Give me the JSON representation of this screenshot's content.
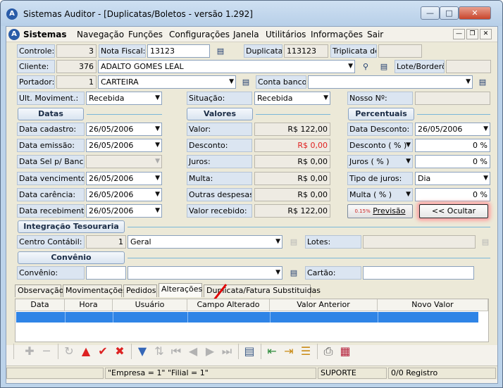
{
  "window": {
    "title": "Sistemas Auditor - [Duplicatas/Boletos - versão 1.292]",
    "app_icon": "auditor-logo-icon"
  },
  "menu": {
    "brand": "Sistemas",
    "items": [
      "Navegação",
      "Funções",
      "Configurações",
      "Janela",
      "Utilitários",
      "Informações",
      "Sair"
    ]
  },
  "header": {
    "controle_label": "Controle:",
    "controle_value": "3",
    "nota_label": "Nota Fiscal:",
    "nota_value": "13123",
    "duplicata_label": "Duplicata:",
    "duplicata_value": "113123",
    "triplicata_label": "Triplicata de:",
    "triplicata_value": "",
    "cliente_label": "Cliente:",
    "cliente_code": "376",
    "cliente_name": "ADALTO GOMES LEAL",
    "lote_label": "Lote/Borderô:",
    "lote_value": "",
    "portador_label": "Portador:",
    "portador_code": "1",
    "portador_name": "CARTEIRA",
    "conta_label": "Conta banco:",
    "conta_value": "",
    "ult_label": "Ult. Moviment.:",
    "ult_value": "Recebida",
    "situacao_label": "Situação:",
    "situacao_value": "Recebida",
    "nosso_label": "Nosso Nº:",
    "nosso_value": ""
  },
  "datas": {
    "title": "Datas",
    "rows": [
      {
        "label": "Data cadastro:",
        "value": "26/05/2006"
      },
      {
        "label": "Data emissão:",
        "value": "26/05/2006"
      },
      {
        "label": "Data Sel p/ Banco:",
        "value": ""
      },
      {
        "label": "Data vencimento:",
        "value": "26/05/2006"
      },
      {
        "label": "Data carência:",
        "value": "26/05/2006"
      },
      {
        "label": "Data recebimento:",
        "value": "26/05/2006"
      }
    ]
  },
  "valores": {
    "title": "Valores",
    "rows": [
      {
        "label": "Valor:",
        "value": "R$ 122,00"
      },
      {
        "label": "Desconto:",
        "value": "R$ 0,00"
      },
      {
        "label": "Juros:",
        "value": "R$ 0,00"
      },
      {
        "label": "Multa:",
        "value": "R$ 0,00"
      },
      {
        "label": "Outras despesas:",
        "value": "R$ 0,00"
      },
      {
        "label": "Valor recebido:",
        "value": "R$ 122,00"
      }
    ]
  },
  "percentuais": {
    "title": "Percentuais",
    "rows": [
      {
        "label": "Data Desconto:",
        "value": "26/05/2006"
      },
      {
        "label": "Desconto ( % )",
        "value": "0 %"
      },
      {
        "label": "Juros ( % )",
        "value": "0 %"
      },
      {
        "label": "Tipo de juros:",
        "value": "Dia"
      },
      {
        "label": "Multa ( % )",
        "value": "0 %"
      }
    ]
  },
  "buttons": {
    "previsao": "Previsão",
    "ocultar": "<< Ocultar",
    "previsao_badge": "0.15%"
  },
  "integracao": {
    "title": "Integração Tesouraria",
    "centro_label": "Centro Contábil:",
    "centro_code": "1",
    "centro_name": "Geral",
    "lotes_label": "Lotes:",
    "lotes_value": ""
  },
  "convenio": {
    "title": "Convênio",
    "label": "Convênio:",
    "code": "",
    "name": "",
    "cartao_label": "Cartão:",
    "cartao_value": ""
  },
  "tabs": [
    "Observação",
    "Movimentações",
    "Pedidos",
    "Alterações",
    "Duplicata/Fatura Substituidas"
  ],
  "active_tab": "Alterações",
  "grid": {
    "columns": [
      "Data",
      "Hora",
      "Usuário",
      "Campo Alterado",
      "Valor Anterior",
      "Novo Valor"
    ],
    "rows": [
      [
        "",
        "",
        "",
        "",
        "",
        ""
      ]
    ]
  },
  "status": {
    "empresa": "\"Empresa = 1\"   \"Filial = 1\"",
    "usuario": "SUPORTE",
    "registro": "0/0 Registro"
  },
  "colors": {
    "accent": "#2f84e6",
    "ocultar_highlight": "#ff9a9a",
    "arrow": "#e00000",
    "desconto_text": "#e02020"
  }
}
